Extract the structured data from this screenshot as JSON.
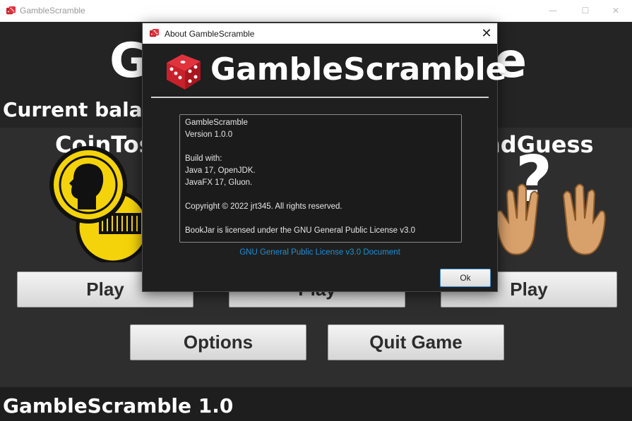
{
  "window": {
    "title": "GambleScramble",
    "minimize_glyph": "—",
    "maximize_glyph": "☐",
    "close_glyph": "✕"
  },
  "main": {
    "heading_left": "G",
    "heading_right": "e",
    "balance_label": "Current balan",
    "games": [
      {
        "title": "CoinTos",
        "play_label": "Play",
        "icon": "coin-head-icon"
      },
      {
        "title": "",
        "play_label": "Play",
        "icon": ""
      },
      {
        "title": "ndGuess",
        "play_label": "Play",
        "icon": "hand-question-icon"
      }
    ],
    "options_label": "Options",
    "quit_label": "Quit Game",
    "footer": "GambleScramble 1.0"
  },
  "dialog": {
    "title": "About GambleScramble",
    "close_glyph": "✕",
    "heading": "GambleScramble",
    "info_lines": [
      "GambleScramble",
      "Version 1.0.0",
      "",
      "Build with:",
      "Java 17, OpenJDK.",
      "JavaFX 17, Gluon.",
      "",
      "Copyright © 2022 jrt345. All rights reserved.",
      "",
      "BookJar is licensed under the GNU General Public License v3.0"
    ],
    "link": "GNU General Public License v3.0 Document",
    "ok_label": "Ok"
  },
  "colors": {
    "dice_red": "#c8212b",
    "coin_yellow": "#f4d30a",
    "hand_skin": "#d8a06a",
    "link_blue": "#1f8fd6"
  }
}
